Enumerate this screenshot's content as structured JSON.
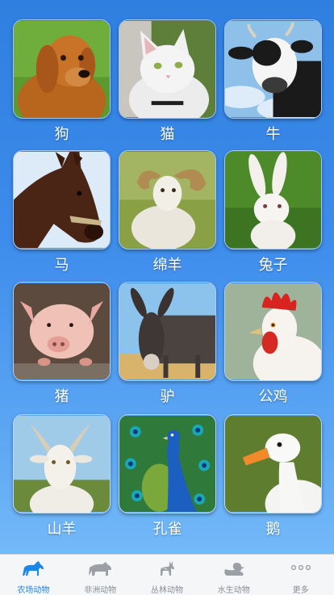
{
  "animals": [
    {
      "label": "狗",
      "image": "golden-retriever-photo"
    },
    {
      "label": "猫",
      "image": "white-cat-photo"
    },
    {
      "label": "牛",
      "image": "black-white-cow-photo"
    },
    {
      "label": "马",
      "image": "brown-horse-photo"
    },
    {
      "label": "绵羊",
      "image": "ram-sheep-photo"
    },
    {
      "label": "兔子",
      "image": "white-rabbit-photo"
    },
    {
      "label": "猪",
      "image": "pink-pig-photo"
    },
    {
      "label": "驴",
      "image": "donkey-photo"
    },
    {
      "label": "公鸡",
      "image": "rooster-photo"
    },
    {
      "label": "山羊",
      "image": "white-goat-photo"
    },
    {
      "label": "孔雀",
      "image": "peacock-photo"
    },
    {
      "label": "鹅",
      "image": "white-goose-photo"
    }
  ],
  "tabs": [
    {
      "label": "农场动物",
      "icon": "horse-icon",
      "active": true
    },
    {
      "label": "非洲动物",
      "icon": "rhino-icon",
      "active": false
    },
    {
      "label": "丛林动物",
      "icon": "deer-icon",
      "active": false
    },
    {
      "label": "水生动物",
      "icon": "duck-icon",
      "active": false
    },
    {
      "label": "更多",
      "icon": "more-dots-icon",
      "active": false
    }
  ],
  "colors": {
    "accent": "#1a86e8",
    "inactive": "#8a8f96",
    "background": "#3d8cec"
  }
}
